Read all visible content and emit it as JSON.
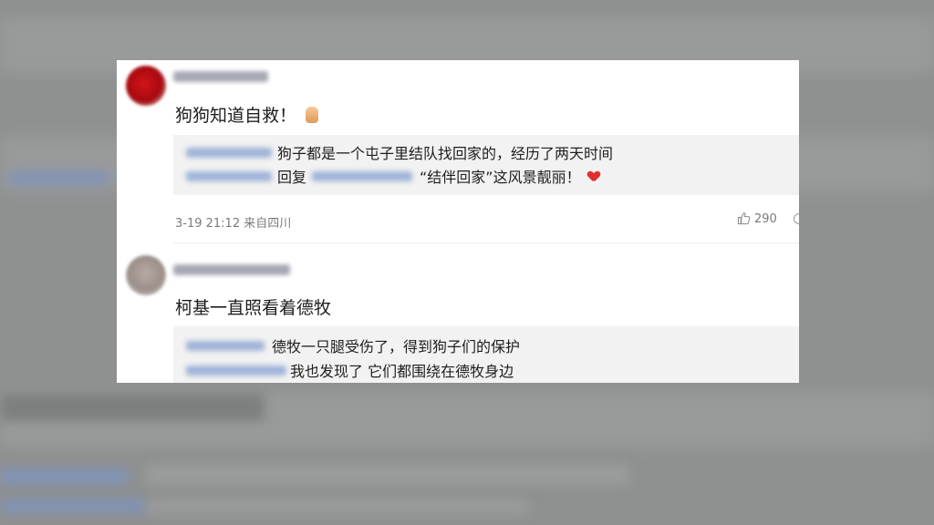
{
  "comments": [
    {
      "text": "狗狗知道自救！",
      "emoji": "thumbs-up-emoji",
      "reply_lines": [
        "狗子都是一个屯子里结队找回家的，经历了两天时间",
        "回复",
        "“结伴回家”这风景靓丽！"
      ],
      "reply_emoji": "heart-emoji",
      "meta": "3-19 21:12 来自四川",
      "likes": "290"
    },
    {
      "text": "柯基一直照看着德牧",
      "reply_lines": [
        "德牧一只腿受伤了，得到狗子们的保护",
        "我也发现了 它们都围绕在德牧身边"
      ]
    }
  ],
  "colors": {
    "background": "#8f9191",
    "card": "#ffffff",
    "reply_box": "#f2f2f2",
    "link_blur": "#9fb3d8",
    "heart": "#e0302c"
  }
}
